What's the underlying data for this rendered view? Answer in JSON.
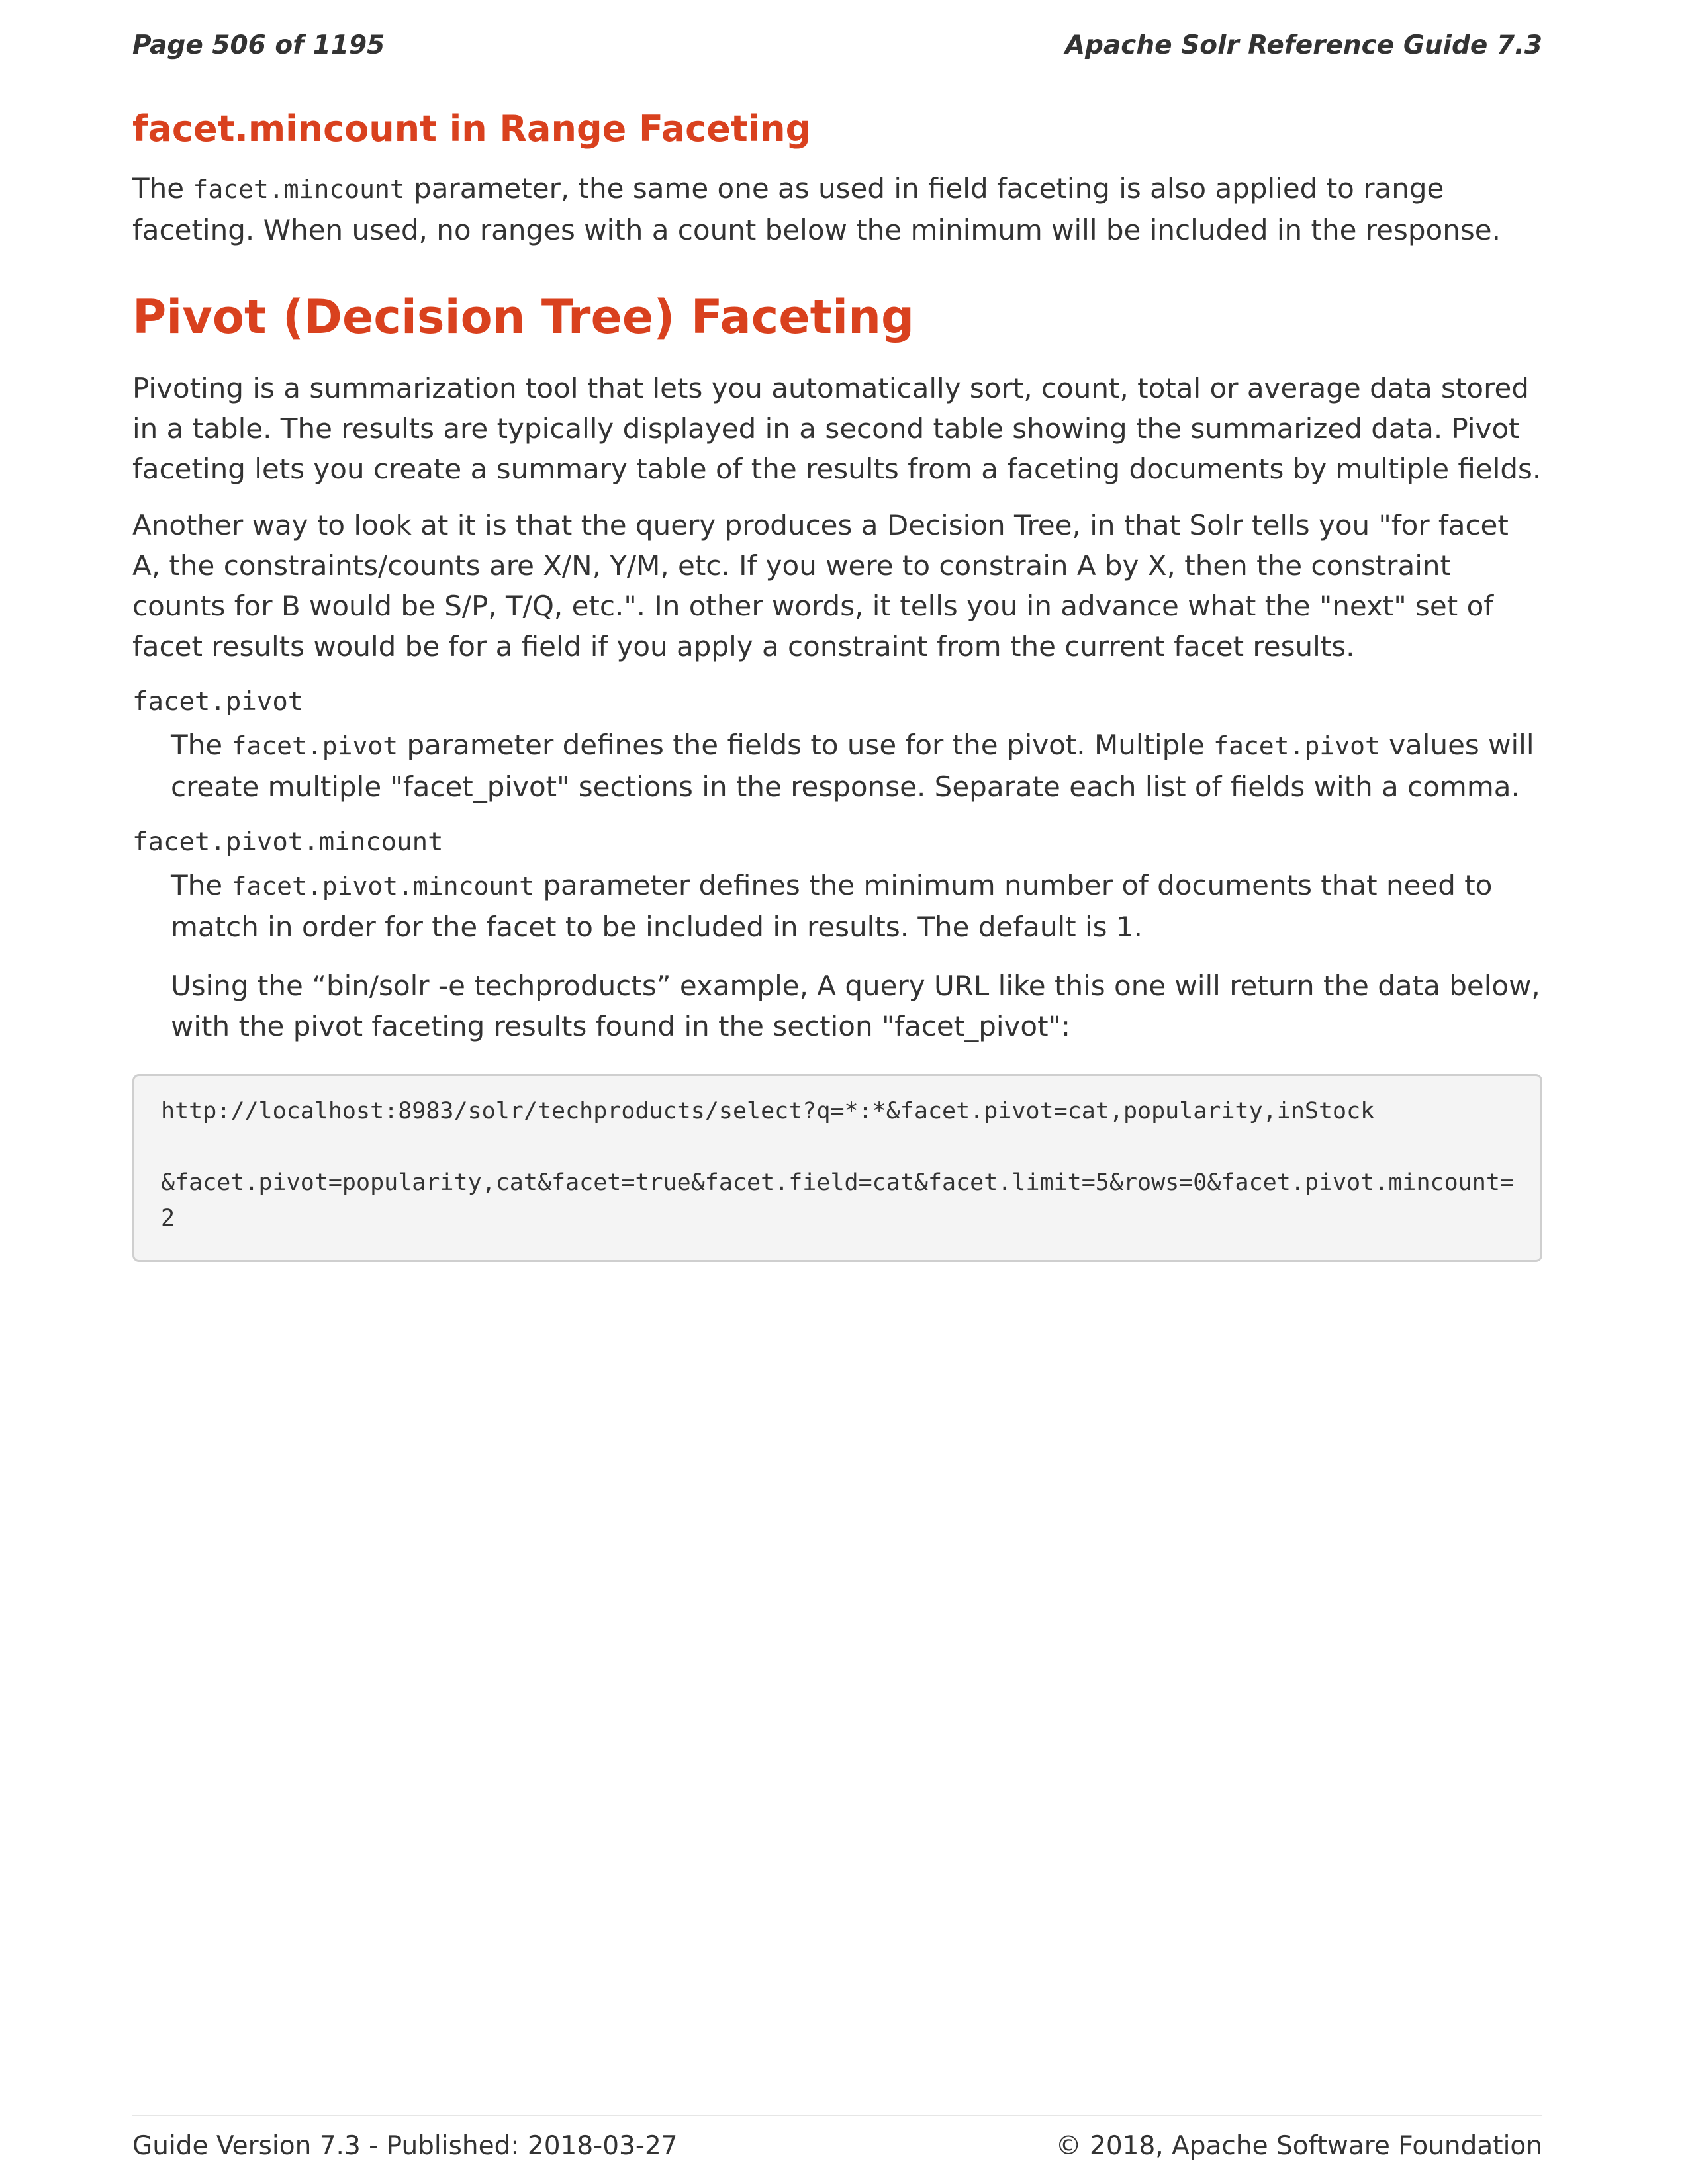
{
  "header": {
    "page_label": "Page 506 of 1195",
    "guide_title": "Apache Solr Reference Guide 7.3"
  },
  "section1": {
    "title": "facet.mincount in Range Faceting",
    "p1_pre": "The ",
    "p1_code": "facet.mincount",
    "p1_post": " parameter, the same one as used in field faceting is also applied to range faceting. When used, no ranges with a count below the minimum will be included in the response."
  },
  "section2": {
    "title": "Pivot (Decision Tree) Faceting",
    "para1": "Pivoting is a summarization tool that lets you automatically sort, count, total or average data stored in a table. The results are typically displayed in a second table showing the summarized data. Pivot faceting lets you create a summary table of the results from a faceting documents by multiple fields.",
    "para2": "Another way to look at it is that the query produces a Decision Tree, in that Solr tells you \"for facet A, the constraints/counts are X/N, Y/M, etc. If you were to constrain A by X, then the constraint counts for B would be S/P, T/Q, etc.\". In other words, it tells you in advance what the \"next\" set of facet results would be for a field if you apply a constraint from the current facet results."
  },
  "params": {
    "pivot": {
      "term": "facet.pivot",
      "d_pre": "The ",
      "d_code1": "facet.pivot",
      "d_mid": " parameter defines the fields to use for the pivot. Multiple ",
      "d_code2": "facet.pivot",
      "d_post": " values will create multiple \"facet_pivot\" sections in the response. Separate each list of fields with a comma."
    },
    "mincount": {
      "term": "facet.pivot.mincount",
      "d_pre": "The ",
      "d_code": "facet.pivot.mincount",
      "d_post": " parameter defines the minimum number of documents that need to match in order for the facet to be included in results. The default is 1.",
      "example": "Using the “bin/solr -e techproducts” example, A query URL like this one will return the data below, with the pivot faceting results found in the section \"facet_pivot\":"
    }
  },
  "code_block": {
    "line1": "http://localhost:8983/solr/techproducts/select?q=*:*&facet.pivot=cat,popularity,inStock",
    "line2": "&facet.pivot=popularity,cat&facet=true&facet.field=cat&facet.limit=5&rows=0&facet.pivot.mincount=2"
  },
  "footer": {
    "version": "Guide Version 7.3 - Published: 2018-03-27",
    "copyright": "© 2018, Apache Software Foundation"
  }
}
